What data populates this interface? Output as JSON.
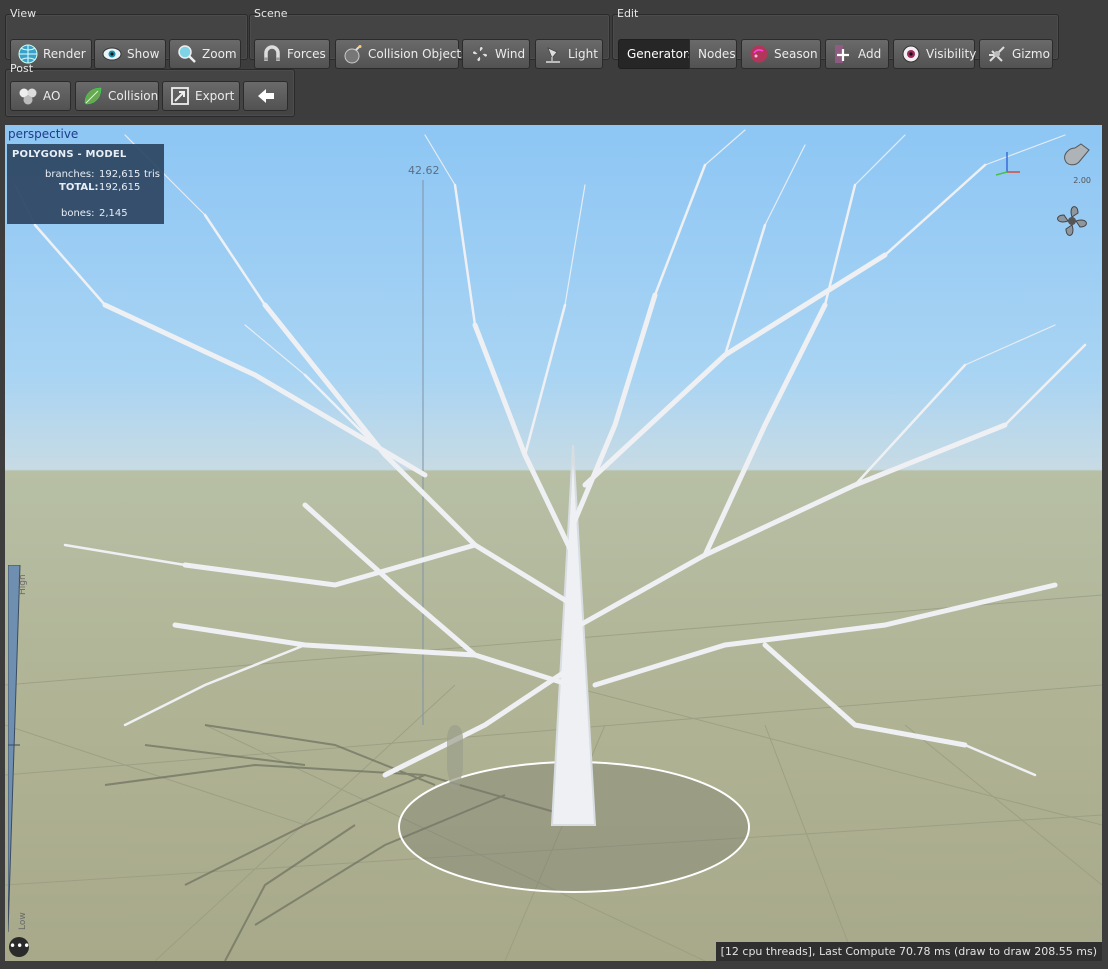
{
  "toolbar": {
    "view": {
      "title": "View",
      "render": "Render",
      "show": "Show",
      "zoom": "Zoom"
    },
    "scene": {
      "title": "Scene",
      "forces": "Forces",
      "collision_objects": "Collision Objects",
      "wind": "Wind",
      "light": "Light"
    },
    "edit": {
      "title": "Edit",
      "generators": "Generators",
      "nodes": "Nodes",
      "season": "Season",
      "add": "Add",
      "visibility": "Visibility",
      "gizmo": "Gizmo"
    },
    "post": {
      "title": "Post",
      "ao": "AO",
      "collision": "Collision",
      "export": "Export"
    }
  },
  "viewport": {
    "camera": "perspective",
    "polygons": {
      "title": "POLYGONS - MODEL",
      "branches_label": "branches:",
      "branches_value": "192,615",
      "branches_unit": "tris",
      "total_label": "TOTAL:",
      "total_value": "192,615",
      "bones_label": "bones:",
      "bones_value": "2,145"
    },
    "height_readout": "42.62",
    "zoom_value": "2.00",
    "scale_high": "High",
    "scale_low": "Low",
    "more": "•••",
    "status": "[12 cpu threads], Last Compute 70.78 ms (draw to draw 208.55 ms)"
  },
  "icons": [
    "globe-icon",
    "eye-icon",
    "magnifier-icon",
    "magnet-icon",
    "bomb-icon",
    "fan-icon",
    "spotlight-icon",
    "ladybug-icon",
    "add-node-icon",
    "eyeball-icon",
    "gizmo-icon",
    "ao-spheres-icon",
    "leaf-icon",
    "export-icon",
    "back-arrow-icon",
    "lamp-icon",
    "fan-gizmo-icon"
  ],
  "colors": {
    "active_button": "#262626",
    "sky": "#8dc6f4",
    "ground": "#b0b394",
    "panel": "#2d445f",
    "selection": "#ffffff"
  }
}
